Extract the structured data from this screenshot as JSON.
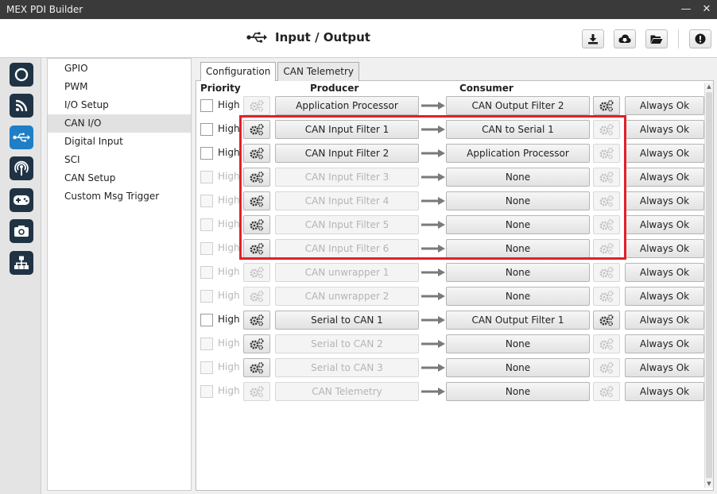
{
  "app": {
    "title": "MEX PDI Builder"
  },
  "header": {
    "title": "Input / Output"
  },
  "iconbar": {
    "items": [
      {
        "icon": "power-icon"
      },
      {
        "icon": "rss-icon"
      },
      {
        "icon": "usb-icon"
      },
      {
        "icon": "antenna-icon"
      },
      {
        "icon": "gamepad-icon"
      },
      {
        "icon": "camera-icon"
      },
      {
        "icon": "network-icon"
      }
    ]
  },
  "menu": {
    "items": [
      "GPIO",
      "PWM",
      "I/O Setup",
      "CAN I/O",
      "Digital Input",
      "SCI",
      "CAN Setup",
      "Custom Msg Trigger"
    ],
    "selected": "CAN I/O"
  },
  "tabs": [
    "Configuration",
    "CAN Telemetry"
  ],
  "columns": {
    "priority": "Priority",
    "producer": "Producer",
    "consumer": "Consumer"
  },
  "rows": [
    {
      "priority": "High",
      "producer": "Application Processor",
      "consumer": "CAN Output Filter 2",
      "status": "Always Ok"
    },
    {
      "priority": "High",
      "producer": "CAN Input Filter 1",
      "consumer": "CAN to Serial 1",
      "status": "Always Ok"
    },
    {
      "priority": "High",
      "producer": "CAN Input Filter 2",
      "consumer": "Application Processor",
      "status": "Always Ok"
    },
    {
      "priority": "High",
      "producer": "CAN Input Filter 3",
      "consumer": "None",
      "status": "Always Ok"
    },
    {
      "priority": "High",
      "producer": "CAN Input Filter 4",
      "consumer": "None",
      "status": "Always Ok"
    },
    {
      "priority": "High",
      "producer": "CAN Input Filter 5",
      "consumer": "None",
      "status": "Always Ok"
    },
    {
      "priority": "High",
      "producer": "CAN Input Filter 6",
      "consumer": "None",
      "status": "Always Ok"
    },
    {
      "priority": "High",
      "producer": "CAN unwrapper 1",
      "consumer": "None",
      "status": "Always Ok"
    },
    {
      "priority": "High",
      "producer": "CAN unwrapper 2",
      "consumer": "None",
      "status": "Always Ok"
    },
    {
      "priority": "High",
      "producer": "Serial to CAN 1",
      "consumer": "CAN Output Filter 1",
      "status": "Always Ok"
    },
    {
      "priority": "High",
      "producer": "Serial to CAN 2",
      "consumer": "None",
      "status": "Always Ok"
    },
    {
      "priority": "High",
      "producer": "Serial to CAN 3",
      "consumer": "None",
      "status": "Always Ok"
    },
    {
      "priority": "High",
      "producer": "CAN Telemetry",
      "consumer": "None",
      "status": "Always Ok"
    }
  ]
}
